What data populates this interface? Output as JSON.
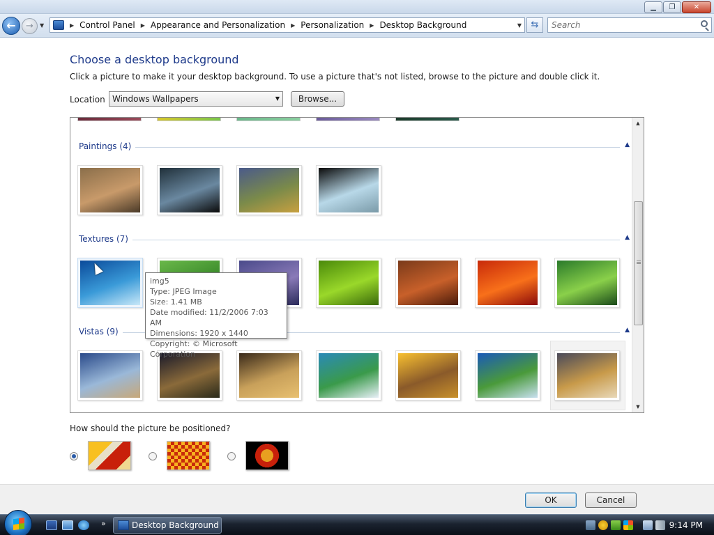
{
  "titlebar": {
    "minimize": "▁",
    "maximize": "❐",
    "close": "✕"
  },
  "address": {
    "breadcrumbs": [
      "Control Panel",
      "Appearance and Personalization",
      "Personalization",
      "Desktop Background"
    ],
    "search_placeholder": "Search"
  },
  "page": {
    "title": "Choose a desktop background",
    "description": "Click a picture to make it your desktop background. To use a picture that's not listed, browse to the picture and double click it.",
    "location_label": "Location",
    "location_value": "Windows Wallpapers",
    "browse_label": "Browse..."
  },
  "groups": [
    {
      "title": "Paintings (4)",
      "items": [
        {
          "colors": [
            "#8a6e4a",
            "#c89a6a",
            "#4a3a28"
          ]
        },
        {
          "colors": [
            "#20303a",
            "#6a88a0",
            "#0a0a0a"
          ]
        },
        {
          "colors": [
            "#4a5a8a",
            "#7a8a4a",
            "#c8a040"
          ]
        },
        {
          "colors": [
            "#0a0a0a",
            "#b8d8e8",
            "#7a9aa8"
          ]
        }
      ]
    },
    {
      "title": "Textures (7)",
      "items": [
        {
          "colors": [
            "#0a4a9a",
            "#3a9ad8",
            "#c8e8f8"
          ]
        },
        {
          "colors": [
            "#6ab84a",
            "#3a8a2a",
            "#c8e8a8"
          ]
        },
        {
          "colors": [
            "#4a4a8a",
            "#8a7ab8",
            "#2a2a5a"
          ]
        },
        {
          "colors": [
            "#4a8a0a",
            "#9ad82a",
            "#3a6a0a"
          ]
        },
        {
          "colors": [
            "#7a3a1a",
            "#c8602a",
            "#4a1a0a"
          ]
        },
        {
          "colors": [
            "#c82a0a",
            "#f8701a",
            "#8a0a0a"
          ]
        },
        {
          "colors": [
            "#2a7a2a",
            "#8ad04a",
            "#1a4a1a"
          ]
        }
      ]
    },
    {
      "title": "Vistas (9)",
      "items": [
        {
          "colors": [
            "#2a4a8a",
            "#9ab8d8",
            "#c8a878"
          ]
        },
        {
          "colors": [
            "#1a1a2a",
            "#8a6a3a",
            "#2a2a1a"
          ]
        },
        {
          "colors": [
            "#3a2a1a",
            "#c8a05a",
            "#e8c070"
          ]
        },
        {
          "colors": [
            "#2a8ab8",
            "#3a9a4a",
            "#e8f0f8"
          ]
        },
        {
          "colors": [
            "#f8c030",
            "#8a5a2a",
            "#c8902a"
          ]
        },
        {
          "colors": [
            "#1a5ab8",
            "#4a9a3a",
            "#c8e0f0"
          ]
        },
        {
          "colors": [
            "#4a4a5a",
            "#c89a4a",
            "#e8d8b8"
          ]
        }
      ]
    }
  ],
  "tooltip": {
    "name": "img5",
    "type": "Type: JPEG Image",
    "size": "Size: 1.41 MB",
    "modified": "Date modified: 11/2/2006 7:03 AM",
    "dimensions": "Dimensions: 1920 x 1440",
    "copyright": "Copyright: © Microsoft Corporation"
  },
  "position": {
    "question": "How should the picture be positioned?",
    "options": [
      "fill",
      "tile",
      "center"
    ],
    "selected": "fill"
  },
  "buttons": {
    "ok": "OK",
    "cancel": "Cancel"
  },
  "taskbar": {
    "active_window": "Desktop Background",
    "quicklaunch_more": "»",
    "clock": "9:14 PM"
  },
  "colors": {
    "title_blue": "#1e3a8a",
    "accent": "#2a5ba8"
  }
}
